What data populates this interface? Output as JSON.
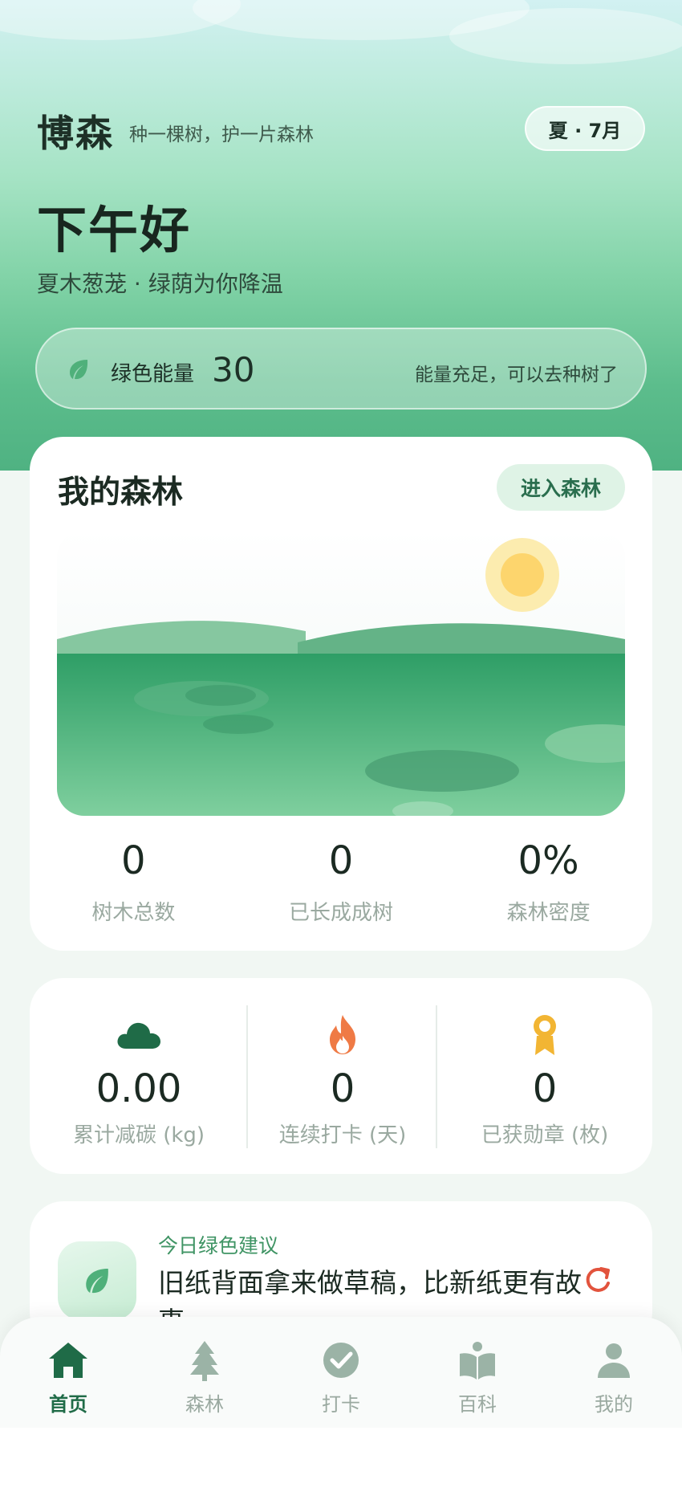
{
  "header": {
    "brand": "博森",
    "slogan": "种一棵树，护一片森林",
    "season": "夏 · 7月",
    "greeting": "下午好",
    "subtitle": "夏木葱茏 · 绿荫为你降温"
  },
  "energy": {
    "icon": "leaf-icon",
    "label": "绿色能量",
    "value": "30",
    "hint": "能量充足，可以去种树了"
  },
  "forest": {
    "title": "我的森林",
    "enter_label": "进入森林",
    "stats": [
      {
        "value": "0",
        "label": "树木总数"
      },
      {
        "value": "0",
        "label": "已长成成树"
      },
      {
        "value": "0%",
        "label": "森林密度"
      }
    ]
  },
  "metrics": [
    {
      "icon": "cloud-icon",
      "value": "0.00",
      "label": "累计减碳 (kg)",
      "color": "#1f6b47"
    },
    {
      "icon": "flame-icon",
      "value": "0",
      "label": "连续打卡 (天)",
      "color": "#ef7a45"
    },
    {
      "icon": "medal-icon",
      "value": "0",
      "label": "已获勋章 (枚)",
      "color": "#f2b533"
    }
  ],
  "tip": {
    "icon": "leaf-icon",
    "label": "今日绿色建议",
    "text": "旧纸背面拿来做草稿，比新纸更有故事",
    "refresh_icon": "refresh-icon"
  },
  "tabs": [
    {
      "icon": "home-icon",
      "label": "首页",
      "active": true
    },
    {
      "icon": "tree-icon",
      "label": "森林",
      "active": false
    },
    {
      "icon": "check-circle-icon",
      "label": "打卡",
      "active": false
    },
    {
      "icon": "book-icon",
      "label": "百科",
      "active": false
    },
    {
      "icon": "user-icon",
      "label": "我的",
      "active": false
    }
  ],
  "colors": {
    "brand_green": "#1f6b47",
    "accent_green": "#4fb282",
    "muted_text": "#9aa9a0"
  }
}
